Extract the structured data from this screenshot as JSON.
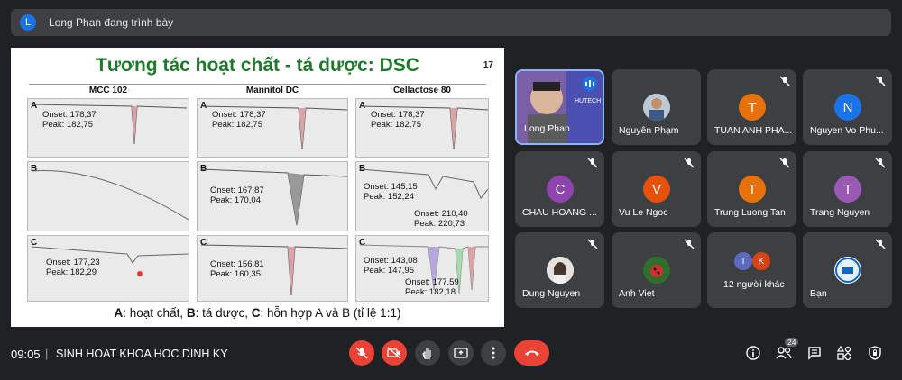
{
  "banner": {
    "avatar_letter": "L",
    "text": "Long Phan đang trình bày"
  },
  "slide": {
    "title": "Tương tác hoạt chất - tá dược: DSC",
    "number": "17",
    "columns": [
      {
        "header": "MCC 102",
        "panels": [
          {
            "label": "A",
            "onset": "Onset: 178,37",
            "peak": "Peak: 182,75"
          },
          {
            "label": "B",
            "onset": "",
            "peak": ""
          },
          {
            "label": "C",
            "onset": "Onset: 177,23",
            "peak": "Peak: 182,29"
          }
        ]
      },
      {
        "header": "Mannitol DC",
        "panels": [
          {
            "label": "A",
            "onset": "Onset: 178,37",
            "peak": "Peak: 182,75"
          },
          {
            "label": "B",
            "onset": "Onset: 167,87",
            "peak": "Peak: 170,04"
          },
          {
            "label": "C",
            "onset": "Onset: 156,81",
            "peak": "Peak: 160,35"
          }
        ]
      },
      {
        "header": "Cellactose 80",
        "panels": [
          {
            "label": "A",
            "onset": "Onset: 178,37",
            "peak": "Peak: 182,75"
          },
          {
            "label": "B",
            "onset": "Onset: 145,15",
            "peak": "Peak: 152,24",
            "onset2": "Onset: 210,40",
            "peak2": "Peak: 220,73"
          },
          {
            "label": "C",
            "onset": "Onset: 143,08",
            "peak": "Peak: 147,95",
            "onset2": "Onset: 177,59",
            "peak2": "Peak: 182,18"
          }
        ]
      }
    ],
    "caption_a": "A",
    "caption_a_text": ": hoạt chất, ",
    "caption_b": "B",
    "caption_b_text": ": tá dược, ",
    "caption_c": "C",
    "caption_c_text": ": hỗn hợp A và B (tỉ lệ 1:1)"
  },
  "participants": [
    {
      "name": "Long Phan",
      "type": "video",
      "muted": false,
      "video_overlay": "HUTECH"
    },
    {
      "name": "Nguyên Phạm",
      "type": "photo",
      "muted": false
    },
    {
      "name": "TUAN ANH PHA...",
      "type": "letter",
      "letter": "T",
      "color": "#e8710a",
      "muted": true
    },
    {
      "name": "Nguyen Vo Phu...",
      "type": "letter",
      "letter": "N",
      "color": "#1a73e8",
      "muted": true
    },
    {
      "name": "CHAU HOANG ...",
      "type": "letter",
      "letter": "C",
      "color": "#8e44ad",
      "muted": true
    },
    {
      "name": "Vu Le Ngoc",
      "type": "letter",
      "letter": "V",
      "color": "#e8710a",
      "muted": true
    },
    {
      "name": "Trung Luong Tan",
      "type": "letter",
      "letter": "T",
      "color": "#e8710a",
      "muted": true
    },
    {
      "name": "Trang Nguyen",
      "type": "letter",
      "letter": "T",
      "color": "#9b59b6",
      "muted": true
    },
    {
      "name": "Dung Nguyen",
      "type": "photo",
      "muted": true
    },
    {
      "name": "Anh Viet",
      "type": "photo",
      "muted": true
    },
    {
      "name": "12 người khác",
      "type": "group",
      "letters": [
        "T",
        "K"
      ],
      "muted": false
    },
    {
      "name": "Bạn",
      "type": "photo",
      "muted": true
    }
  ],
  "bottom": {
    "time": "09:05",
    "separator": "|",
    "meeting_name": "SINH HOAT KHOA HOC DINH KY",
    "participant_count": "24"
  },
  "colors": {
    "accent_red": "#ea4335",
    "tile_bg": "#3c4043",
    "bg": "#202124",
    "title_green": "#1e7a2a"
  }
}
